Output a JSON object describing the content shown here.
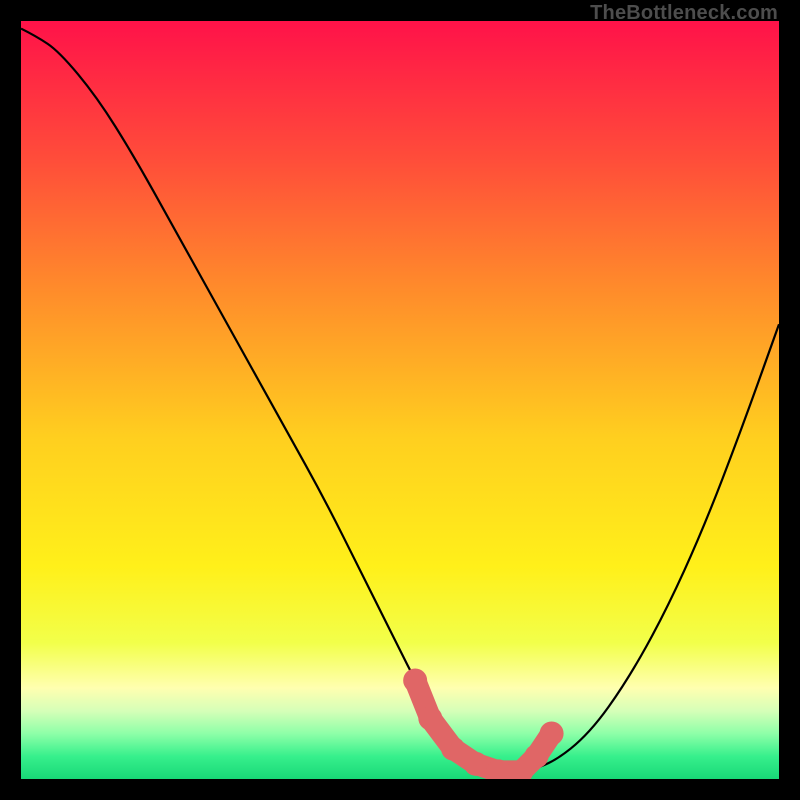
{
  "watermark": "TheBottleneck.com",
  "chart_data": {
    "type": "line",
    "title": "",
    "xlabel": "",
    "ylabel": "",
    "xlim": [
      0,
      100
    ],
    "ylim": [
      0,
      100
    ],
    "series": [
      {
        "name": "curve",
        "x": [
          0,
          2,
          5,
          10,
          15,
          20,
          25,
          30,
          35,
          40,
          45,
          50,
          52,
          55,
          58,
          60,
          63,
          66,
          70,
          75,
          80,
          85,
          90,
          95,
          100
        ],
        "y": [
          99,
          98,
          96,
          90,
          82,
          73,
          64,
          55,
          46,
          37,
          27,
          17,
          13,
          8,
          4,
          2,
          1,
          1,
          2,
          6,
          13,
          22,
          33,
          46,
          60
        ]
      }
    ],
    "markers": {
      "name": "fit-points",
      "color": "#e06666",
      "x": [
        52,
        54,
        57,
        60,
        63,
        66,
        68,
        70
      ],
      "y": [
        13,
        8,
        4,
        2,
        1,
        1,
        3,
        6
      ]
    },
    "gradient_stops": [
      {
        "offset": 0,
        "color": "#ff1249"
      },
      {
        "offset": 18,
        "color": "#ff4c3a"
      },
      {
        "offset": 35,
        "color": "#ff8a2b"
      },
      {
        "offset": 55,
        "color": "#ffcf1f"
      },
      {
        "offset": 72,
        "color": "#fff01a"
      },
      {
        "offset": 82,
        "color": "#f2ff4a"
      },
      {
        "offset": 88,
        "color": "#ffffb0"
      },
      {
        "offset": 91,
        "color": "#d6ffb8"
      },
      {
        "offset": 94,
        "color": "#8effa8"
      },
      {
        "offset": 97,
        "color": "#37f08c"
      },
      {
        "offset": 100,
        "color": "#18d877"
      }
    ]
  }
}
